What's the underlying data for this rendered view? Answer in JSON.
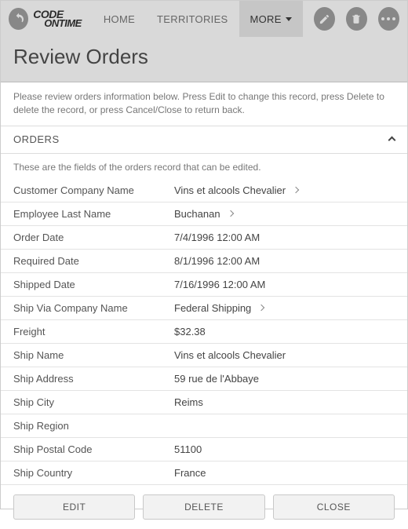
{
  "header": {
    "logo_line1": "CODE",
    "logo_line2": "ONTIME",
    "nav": {
      "home": "HOME",
      "territories": "TERRITORIES",
      "more": "MORE"
    }
  },
  "page": {
    "title": "Review Orders",
    "instructions": "Please review orders information below. Press Edit to change this record, press Delete to delete the record, or press Cancel/Close to return back."
  },
  "section": {
    "title": "ORDERS",
    "description": "These are the fields of the orders record that can be edited."
  },
  "fields": {
    "customer_company_name": {
      "label": "Customer Company Name",
      "value": "Vins et alcools Chevalier",
      "link": true
    },
    "employee_last_name": {
      "label": "Employee Last Name",
      "value": "Buchanan",
      "link": true
    },
    "order_date": {
      "label": "Order Date",
      "value": "7/4/1996 12:00 AM"
    },
    "required_date": {
      "label": "Required Date",
      "value": "8/1/1996 12:00 AM"
    },
    "shipped_date": {
      "label": "Shipped Date",
      "value": "7/16/1996 12:00 AM"
    },
    "ship_via_company_name": {
      "label": "Ship Via Company Name",
      "value": "Federal Shipping",
      "link": true
    },
    "freight": {
      "label": "Freight",
      "value": "$32.38"
    },
    "ship_name": {
      "label": "Ship Name",
      "value": "Vins et alcools Chevalier"
    },
    "ship_address": {
      "label": "Ship Address",
      "value": "59 rue de l'Abbaye"
    },
    "ship_city": {
      "label": "Ship City",
      "value": "Reims"
    },
    "ship_region": {
      "label": "Ship Region",
      "value": ""
    },
    "ship_postal_code": {
      "label": "Ship Postal Code",
      "value": "51100"
    },
    "ship_country": {
      "label": "Ship Country",
      "value": "France"
    }
  },
  "footer": {
    "edit": "EDIT",
    "delete": "DELETE",
    "close": "CLOSE"
  }
}
